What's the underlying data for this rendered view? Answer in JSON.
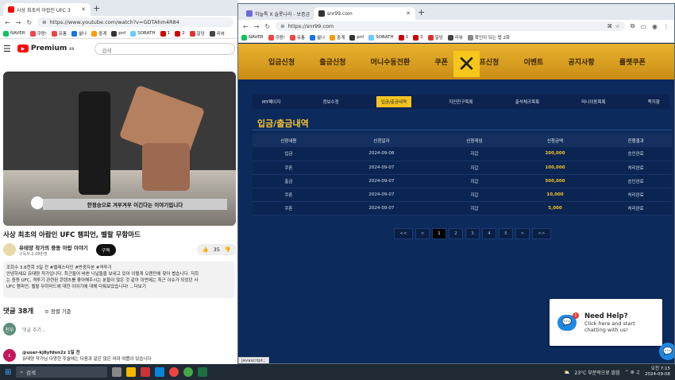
{
  "left_window": {
    "tab_title": "사상 최초의 아랍인 UFC 3",
    "url": "https://www.youtube.com/watch?v=GDTAhm4R84",
    "bookmarks": [
      "NAVER",
      "쿠팡!",
      "유통",
      "쉴나",
      "중계",
      "pnf",
      "SOBATH",
      "1",
      "2",
      "일당",
      "리뷰"
    ],
    "youtube": {
      "logo": "Premium",
      "logo_kr": "KR",
      "search_placeholder": "검색",
      "caption": "한정승으로 겨우겨우 이긴다는 이야기입니다",
      "title": "사상 최초의 아랍인 UFC 챔피언, 벨랄 무함마드",
      "channel": "유태양 작가의 중동 아랍 이야기",
      "subs": "구독자 2.08만명",
      "subscribe": "구독",
      "likes": "35",
      "desc_line1": "조회수 3.8천회  3일 전  #벨레스타인 #반중자본 #격투기",
      "desc_line2": "안녕하세요 유태양 작가입니다. 최근들어 바쁜 나날들을 보내고 있어 이렇게 오랜만에 찾아 뵙습니다. 저희",
      "desc_line3": "는 중동 UFC, 격투기 관련된 콘텐츠를 좋아해주시는 분들이 많은 것 같아 이번에는 최근 이슈가 되었던 사",
      "desc_line4": "UFC 챔피언, 벨랄 무하마드에 대한 이야기에 대해 다뤄보았습니다! ...더보기",
      "comments_count": "댓글 38개",
      "sort": "정렬 기준",
      "add_comment": "댓글 추가...",
      "commenter": "@user-kj8yfdsn2z  1일 전",
      "comment_text": "유태양 작가님 다양한 주술에는 다음과 같은 많은 어려 여쭙이 있습니다"
    }
  },
  "right_window": {
    "tabs": [
      "하늘톡 X 슬롯나라 - 보증금 2%",
      "snr99.com"
    ],
    "url": "https://snr99.com",
    "bookmarks": [
      "NAVER",
      "쿠팡!",
      "유통",
      "쉴나",
      "중계",
      "pnf",
      "SOBATH",
      "1",
      "2",
      "일당",
      "리뷰",
      "확인이 되는 법 2화"
    ],
    "nav": [
      "입금신청",
      "출금신청",
      "머니수동전환",
      "쿠폰",
      "콤프신청",
      "이벤트",
      "공지사항",
      "룰렛쿠폰"
    ],
    "subtabs": [
      "MY페이지",
      "정보수정",
      "입금/출금내역",
      "지인친구목록",
      "출석체크목록",
      "머니이동목록",
      "쪽지함"
    ],
    "active_subtab": 2,
    "page_title": "입금/출금내역",
    "columns": [
      "신청내용",
      "신청일자",
      "신청게임",
      "신청금액",
      "진행결과"
    ],
    "rows": [
      [
        "입금",
        "2024-09-08",
        "지갑",
        "200,000",
        "승인완료"
      ],
      [
        "쿠폰",
        "2024-09-07",
        "지갑",
        "100,000",
        "처리완료"
      ],
      [
        "출금",
        "2024-09-07",
        "지갑",
        "500,000",
        "승인완료"
      ],
      [
        "쿠폰",
        "2024-09-07",
        "지갑",
        "10,000",
        "처리완료"
      ],
      [
        "쿠폰",
        "2024-09-07",
        "지갑",
        "5,000",
        "처리완료"
      ]
    ],
    "pager": [
      "<<",
      "<",
      "1",
      "2",
      "3",
      "4",
      "5",
      ">",
      ">>"
    ],
    "help_title": "Need Help?",
    "help_line1": "Click here and start",
    "help_line2": "chatting with us!",
    "help_badge": "1",
    "status": "javascript:;"
  },
  "taskbar": {
    "search": "검색",
    "weather": "23°C  부분적으로 맑음",
    "time": "오전 7:15",
    "date": "2024-09-08"
  }
}
